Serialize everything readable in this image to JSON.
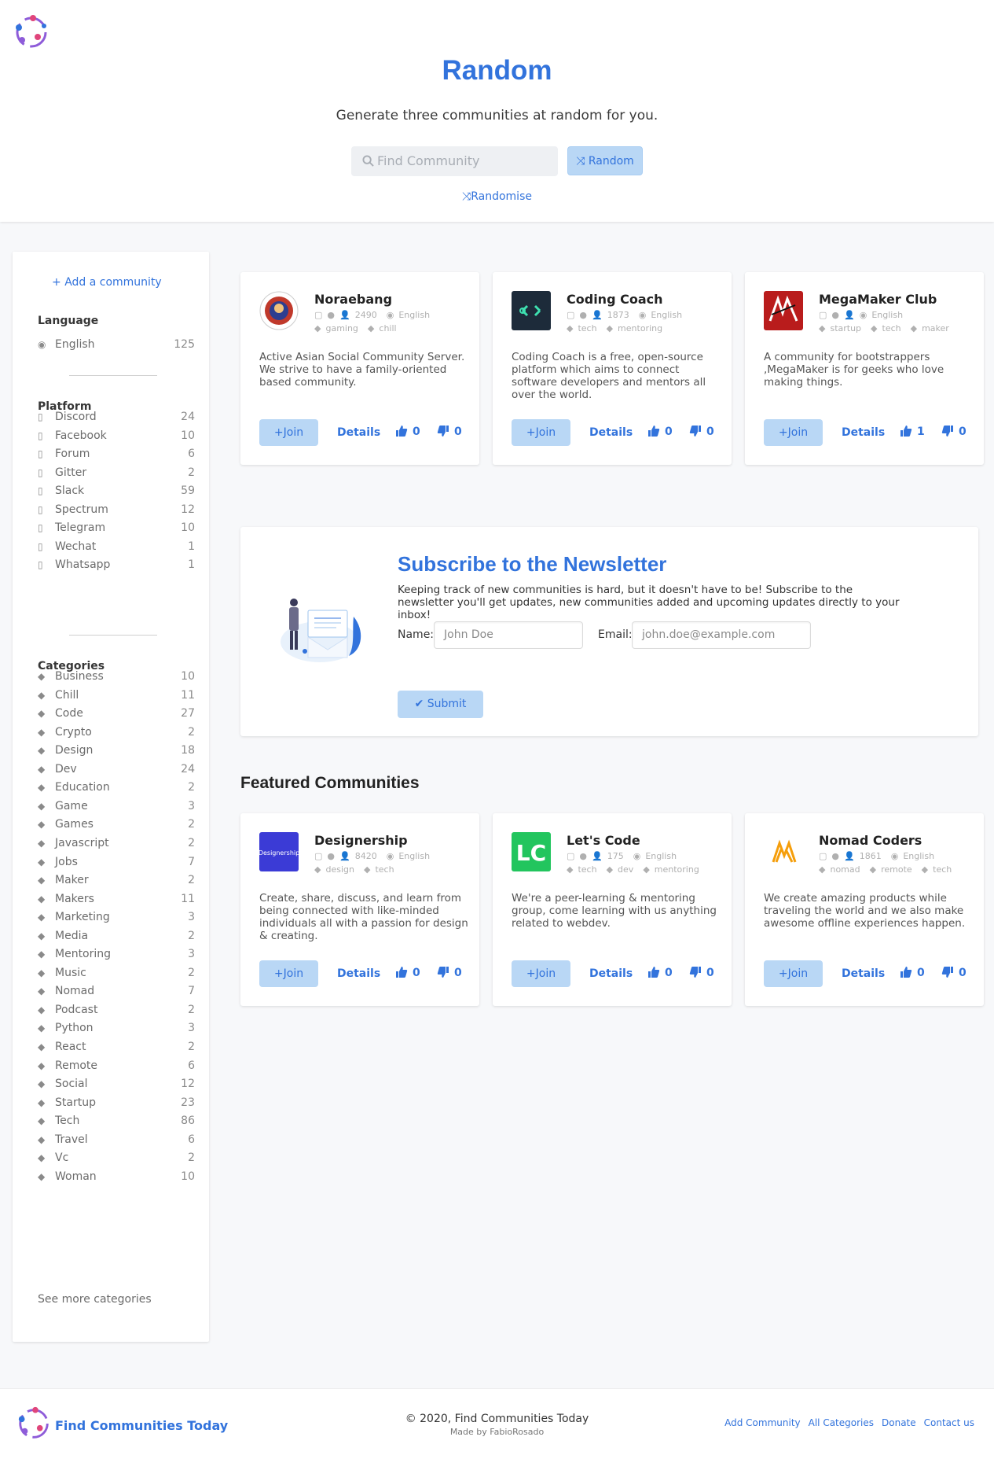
{
  "hero": {
    "title": "Random",
    "subtitle": "Generate three communities at random for you.",
    "search_placeholder": "Find Community",
    "random_button": "Random",
    "randomise_link": "Randomise"
  },
  "sidebar": {
    "add_community": "Add a community",
    "language_heading": "Language",
    "languages": [
      {
        "label": "English",
        "count": "125"
      }
    ],
    "platform_heading": "Platform",
    "platforms": [
      {
        "label": "Discord",
        "count": "24"
      },
      {
        "label": "Facebook",
        "count": "10"
      },
      {
        "label": "Forum",
        "count": "6"
      },
      {
        "label": "Gitter",
        "count": "2"
      },
      {
        "label": "Slack",
        "count": "59"
      },
      {
        "label": "Spectrum",
        "count": "12"
      },
      {
        "label": "Telegram",
        "count": "10"
      },
      {
        "label": "Wechat",
        "count": "1"
      },
      {
        "label": "Whatsapp",
        "count": "1"
      }
    ],
    "categories_heading": "Categories",
    "categories": [
      {
        "label": "Business",
        "count": "10"
      },
      {
        "label": "Chill",
        "count": "11"
      },
      {
        "label": "Code",
        "count": "27"
      },
      {
        "label": "Crypto",
        "count": "2"
      },
      {
        "label": "Design",
        "count": "18"
      },
      {
        "label": "Dev",
        "count": "24"
      },
      {
        "label": "Education",
        "count": "2"
      },
      {
        "label": "Game",
        "count": "3"
      },
      {
        "label": "Games",
        "count": "2"
      },
      {
        "label": "Javascript",
        "count": "2"
      },
      {
        "label": "Jobs",
        "count": "7"
      },
      {
        "label": "Maker",
        "count": "2"
      },
      {
        "label": "Makers",
        "count": "11"
      },
      {
        "label": "Marketing",
        "count": "3"
      },
      {
        "label": "Media",
        "count": "2"
      },
      {
        "label": "Mentoring",
        "count": "3"
      },
      {
        "label": "Music",
        "count": "2"
      },
      {
        "label": "Nomad",
        "count": "7"
      },
      {
        "label": "Podcast",
        "count": "2"
      },
      {
        "label": "Python",
        "count": "3"
      },
      {
        "label": "React",
        "count": "2"
      },
      {
        "label": "Remote",
        "count": "6"
      },
      {
        "label": "Social",
        "count": "12"
      },
      {
        "label": "Startup",
        "count": "23"
      },
      {
        "label": "Tech",
        "count": "86"
      },
      {
        "label": "Travel",
        "count": "6"
      },
      {
        "label": "Vc",
        "count": "2"
      },
      {
        "label": "Woman",
        "count": "10"
      }
    ],
    "see_more": "See more categories"
  },
  "random_cards": [
    {
      "name": "Noraebang",
      "members": "2490",
      "language": "English",
      "tags": [
        "gaming",
        "chill"
      ],
      "description": "Active Asian Social Community Server. We strive to have a family-oriented based community.",
      "join": "+Join",
      "details": "Details",
      "upvotes": "0",
      "downvotes": "0"
    },
    {
      "name": "Coding Coach",
      "members": "1873",
      "language": "English",
      "tags": [
        "tech",
        "mentoring"
      ],
      "description": "Coding Coach is a free, open-source platform which aims to connect software developers and mentors all over the world.",
      "join": "+Join",
      "details": "Details",
      "upvotes": "0",
      "downvotes": "0"
    },
    {
      "name": "MegaMaker Club",
      "members": "",
      "language": "English",
      "tags": [
        "startup",
        "tech",
        "maker"
      ],
      "description": "A community for bootstrappers ,MegaMaker is for geeks who love making things.",
      "join": "+Join",
      "details": "Details",
      "upvotes": "1",
      "downvotes": "0"
    }
  ],
  "newsletter": {
    "title": "Subscribe to the Newsletter",
    "text": "Keeping track of new communities is hard, but it doesn't have to be! Subscribe to the newsletter you'll get updates, new communities added and upcoming updates directly to your inbox!",
    "name_label": "Name:",
    "name_placeholder": "John Doe",
    "email_label": "Email:",
    "email_placeholder": "john.doe@example.com",
    "submit": "Submit"
  },
  "featured": {
    "title": "Featured Communities",
    "cards": [
      {
        "name": "Designership",
        "logo_text": "Designership",
        "members": "8420",
        "language": "English",
        "tags": [
          "design",
          "tech"
        ],
        "description": "Create, share, discuss, and learn from being connected with like-minded individuals all with a passion for design & creating.",
        "join": "+Join",
        "details": "Details",
        "upvotes": "0",
        "downvotes": "0"
      },
      {
        "name": "Let's Code",
        "logo_text": "LC",
        "members": "175",
        "language": "English",
        "tags": [
          "tech",
          "dev",
          "mentoring"
        ],
        "description": "We're a peer-learning & mentoring group, come learning with us anything related to webdev.",
        "join": "+Join",
        "details": "Details",
        "upvotes": "0",
        "downvotes": "0"
      },
      {
        "name": "Nomad Coders",
        "members": "1861",
        "language": "English",
        "tags": [
          "nomad",
          "remote",
          "tech"
        ],
        "description": "We create amazing products while traveling the world and we also make awesome offline experiences happen.",
        "join": "+Join",
        "details": "Details",
        "upvotes": "0",
        "downvotes": "0"
      }
    ]
  },
  "footer": {
    "brand": "Find Communities Today",
    "copyright": "© 2020, Find Communities Today",
    "made_by": "Made by FabioRosado",
    "links": [
      "Add Community",
      "All Categories",
      "Donate",
      "Contact us"
    ]
  },
  "colors": {
    "accent": "#3273dc",
    "button_bg": "#b9d7f5"
  }
}
